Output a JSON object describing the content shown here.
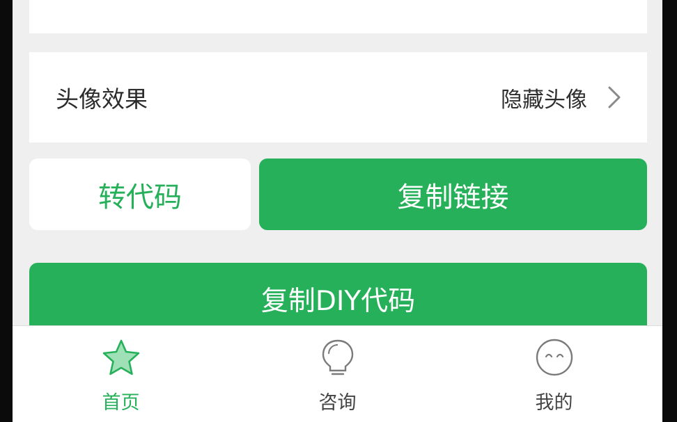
{
  "colors": {
    "accent": "#26b05a",
    "background": "#eeefee",
    "card": "#ffffff",
    "text": "#2b2b2b"
  },
  "settings": {
    "avatar_effect": {
      "label": "头像效果",
      "value": "隐藏头像",
      "icon": "chevron-right-icon"
    }
  },
  "actions": {
    "convert_code": "转代码",
    "copy_link": "复制链接",
    "copy_diy_code": "复制DIY代码"
  },
  "tabbar": {
    "active": "home",
    "tabs": [
      {
        "key": "home",
        "label": "首页",
        "icon": "star-icon"
      },
      {
        "key": "consult",
        "label": "咨询",
        "icon": "lightbulb-icon"
      },
      {
        "key": "mine",
        "label": "我的",
        "icon": "smiley-face-icon"
      }
    ]
  }
}
